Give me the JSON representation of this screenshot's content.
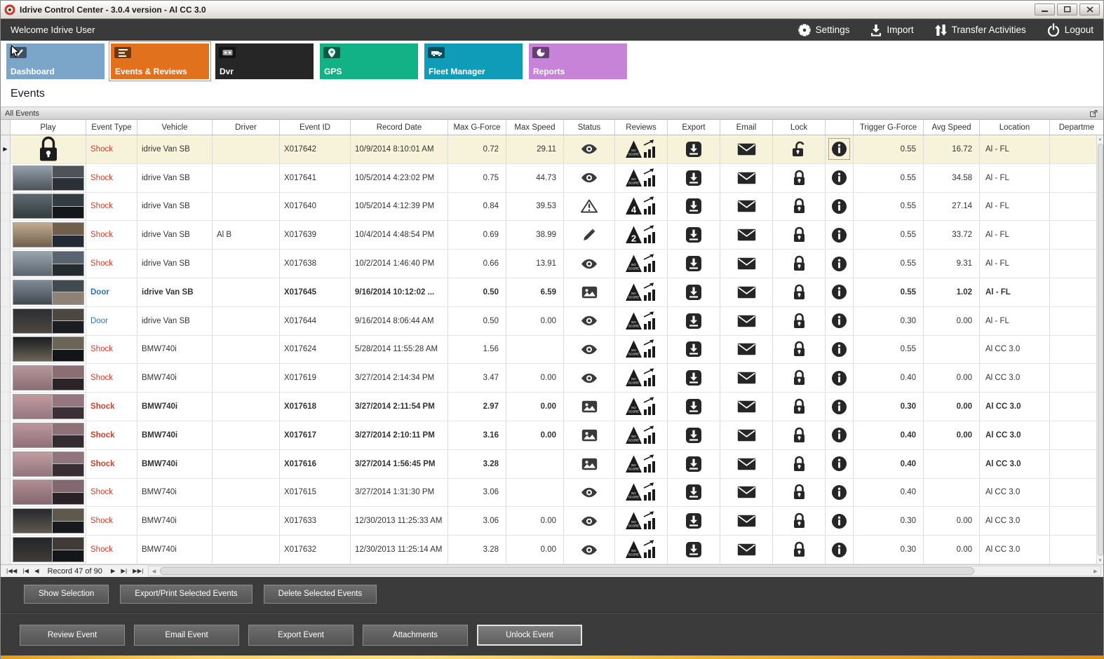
{
  "window": {
    "title": "Idrive Control Center - 3.0.4 version - Al CC 3.0",
    "controls": [
      "minimize",
      "maximize",
      "close"
    ]
  },
  "topbar": {
    "welcome": "Welcome Idrive User",
    "actions": [
      {
        "label": "Settings",
        "icon": "gear-icon"
      },
      {
        "label": "Import",
        "icon": "import-icon"
      },
      {
        "label": "Transfer Activities",
        "icon": "transfer-icon"
      },
      {
        "label": "Logout",
        "icon": "power-icon"
      }
    ]
  },
  "nav_tiles": [
    {
      "label": "Dashboard",
      "icon": "dashboard-check-icon",
      "color": "#7ba6c9",
      "selected": false
    },
    {
      "label": "Events & Reviews",
      "icon": "events-list-icon",
      "color": "#e2711e",
      "selected": true
    },
    {
      "label": "Dvr",
      "icon": "dvr-icon",
      "color": "#262626",
      "selected": false
    },
    {
      "label": "GPS",
      "icon": "gps-pin-icon",
      "color": "#12b286",
      "selected": false
    },
    {
      "label": "Fleet Manager",
      "icon": "fleet-vehicle-icon",
      "color": "#0f9cb9",
      "selected": false
    },
    {
      "label": "Reports",
      "icon": "reports-pie-icon",
      "color": "#c683d8",
      "selected": false
    }
  ],
  "page": {
    "title": "Events",
    "group_header": "All Events"
  },
  "table": {
    "columns": [
      "Play",
      "Event Type",
      "Vehicle",
      "Driver",
      "Event ID",
      "Record Date",
      "Max G-Force",
      "Max Speed",
      "Status",
      "Reviews",
      "Export",
      "Email",
      "Lock",
      "",
      "Trigger G-Force",
      "Avg Speed",
      "Location",
      "Departme"
    ],
    "rows": [
      {
        "event_type": "Shock",
        "vehicle": "idrive Van SB",
        "driver": "",
        "event_id": "X017642",
        "record_date": "10/9/2014 8:10:01 AM",
        "max_g": "0.72",
        "max_speed": "29.11",
        "status": "eye",
        "review": "NO SCORE",
        "lock": "open",
        "trigger_g": "0.55",
        "avg_speed": "16.72",
        "location": "Al - FL",
        "bold": false,
        "selected": true,
        "play": "lock",
        "thumb": null
      },
      {
        "event_type": "Shock",
        "vehicle": "idrive Van SB",
        "driver": "",
        "event_id": "X017641",
        "record_date": "10/5/2014 4:23:02 PM",
        "max_g": "0.75",
        "max_speed": "44.73",
        "status": "eye",
        "review": "NO SCORE",
        "lock": "closed",
        "trigger_g": "0.55",
        "avg_speed": "34.58",
        "location": "Al - FL",
        "bold": false,
        "selected": false,
        "play": "thumb",
        "thumb": [
          "#93a0ab",
          "#4d5359",
          "#2c3137"
        ]
      },
      {
        "event_type": "Shock",
        "vehicle": "idrive Van SB",
        "driver": "",
        "event_id": "X017640",
        "record_date": "10/5/2014 4:12:39 PM",
        "max_g": "0.84",
        "max_speed": "39.53",
        "status": "warning",
        "review": "4",
        "lock": "closed",
        "trigger_g": "0.55",
        "avg_speed": "27.14",
        "location": "Al - FL",
        "bold": false,
        "selected": false,
        "play": "thumb",
        "thumb": [
          "#5d6a70",
          "#333c3e",
          "#15181a"
        ]
      },
      {
        "event_type": "Shock",
        "vehicle": "idrive Van SB",
        "driver": "Al B",
        "event_id": "X017639",
        "record_date": "10/4/2014 4:48:54 PM",
        "max_g": "0.69",
        "max_speed": "38.99",
        "status": "pencil",
        "review": "2",
        "lock": "closed",
        "trigger_g": "0.55",
        "avg_speed": "33.72",
        "location": "Al - FL",
        "bold": false,
        "selected": false,
        "play": "thumb",
        "thumb": [
          "#c3ab8e",
          "#705f4d",
          "#232a36"
        ]
      },
      {
        "event_type": "Shock",
        "vehicle": "idrive Van SB",
        "driver": "",
        "event_id": "X017638",
        "record_date": "10/2/2014 1:46:40 PM",
        "max_g": "0.66",
        "max_speed": "13.91",
        "status": "eye",
        "review": "NO SCORE",
        "lock": "closed",
        "trigger_g": "0.55",
        "avg_speed": "9.31",
        "location": "Al - FL",
        "bold": false,
        "selected": false,
        "play": "thumb",
        "thumb": [
          "#9aa6ae",
          "#596470",
          "#262b31"
        ]
      },
      {
        "event_type": "Door",
        "vehicle": "idrive Van SB",
        "driver": "",
        "event_id": "X017645",
        "record_date": "9/16/2014 10:12:02 ...",
        "max_g": "0.50",
        "max_speed": "6.59",
        "status": "image",
        "review": "NO SCORE",
        "lock": "closed",
        "trigger_g": "0.55",
        "avg_speed": "1.02",
        "location": "Al - FL",
        "bold": true,
        "selected": false,
        "play": "thumb",
        "thumb": [
          "#7e8b96",
          "#424a51",
          "#8d8275"
        ]
      },
      {
        "event_type": "Door",
        "vehicle": "idrive Van SB",
        "driver": "",
        "event_id": "X017644",
        "record_date": "9/16/2014 8:06:44 AM",
        "max_g": "0.50",
        "max_speed": "0.00",
        "status": "eye",
        "review": "NO SCORE",
        "lock": "closed",
        "trigger_g": "0.30",
        "avg_speed": "0.00",
        "location": "Al - FL",
        "bold": false,
        "selected": false,
        "play": "thumb",
        "thumb": [
          "#2b2e33",
          "#4d4741",
          "#1b1d21"
        ]
      },
      {
        "event_type": "Shock",
        "vehicle": "BMW740i",
        "driver": "",
        "event_id": "X017624",
        "record_date": "5/28/2014 11:55:28 AM",
        "max_g": "1.56",
        "max_speed": "",
        "status": "eye",
        "review": "NO SCORE",
        "lock": "closed",
        "trigger_g": "0.55",
        "avg_speed": "",
        "location": "Al CC 3.0",
        "bold": false,
        "selected": false,
        "play": "thumb",
        "thumb": [
          "#1a1c20",
          "#6b6557",
          "#121417"
        ]
      },
      {
        "event_type": "Shock",
        "vehicle": "BMW740i",
        "driver": "",
        "event_id": "X017619",
        "record_date": "3/27/2014 2:14:34 PM",
        "max_g": "3.47",
        "max_speed": "0.00",
        "status": "eye",
        "review": "NO SCORE",
        "lock": "closed",
        "trigger_g": "0.40",
        "avg_speed": "0.00",
        "location": "Al CC 3.0",
        "bold": false,
        "selected": false,
        "play": "thumb",
        "thumb": [
          "#b6969a",
          "#8a6e74",
          "#2b2327"
        ]
      },
      {
        "event_type": "Shock",
        "vehicle": "BMW740i",
        "driver": "",
        "event_id": "X017618",
        "record_date": "3/27/2014 2:11:54 PM",
        "max_g": "2.97",
        "max_speed": "0.00",
        "status": "image",
        "review": "NO SCORE",
        "lock": "closed",
        "trigger_g": "0.30",
        "avg_speed": "0.00",
        "location": "Al CC 3.0",
        "bold": true,
        "selected": false,
        "play": "thumb",
        "thumb": [
          "#c29ba0",
          "#957680",
          "#3b3035"
        ]
      },
      {
        "event_type": "Shock",
        "vehicle": "BMW740i",
        "driver": "",
        "event_id": "X017617",
        "record_date": "3/27/2014 2:10:11 PM",
        "max_g": "3.16",
        "max_speed": "0.00",
        "status": "image",
        "review": "NO SCORE",
        "lock": "closed",
        "trigger_g": "0.40",
        "avg_speed": "0.00",
        "location": "Al CC 3.0",
        "bold": true,
        "selected": false,
        "play": "thumb",
        "thumb": [
          "#bd979c",
          "#8f7078",
          "#352c31"
        ]
      },
      {
        "event_type": "Shock",
        "vehicle": "BMW740i",
        "driver": "",
        "event_id": "X017616",
        "record_date": "3/27/2014 1:56:45 PM",
        "max_g": "3.28",
        "max_speed": "",
        "status": "image",
        "review": "NO SCORE",
        "lock": "closed",
        "trigger_g": "0.40",
        "avg_speed": "",
        "location": "Al CC 3.0",
        "bold": true,
        "selected": false,
        "play": "thumb",
        "thumb": [
          "#c09da1",
          "#92747c",
          "#382e33"
        ]
      },
      {
        "event_type": "Shock",
        "vehicle": "BMW740i",
        "driver": "",
        "event_id": "X017615",
        "record_date": "3/27/2014 1:31:30 PM",
        "max_g": "3.06",
        "max_speed": "",
        "status": "eye",
        "review": "NO SCORE",
        "lock": "closed",
        "trigger_g": "0.40",
        "avg_speed": "",
        "location": "Al CC 3.0",
        "bold": false,
        "selected": false,
        "play": "thumb",
        "thumb": [
          "#b28e92",
          "#846870",
          "#2a2226"
        ]
      },
      {
        "event_type": "Shock",
        "vehicle": "BMW740i",
        "driver": "",
        "event_id": "X017633",
        "record_date": "12/30/2013 11:25:33 AM",
        "max_g": "3.06",
        "max_speed": "0.00",
        "status": "eye",
        "review": "NO SCORE",
        "lock": "closed",
        "trigger_g": "0.30",
        "avg_speed": "0.00",
        "location": "Al CC 3.0",
        "bold": false,
        "selected": false,
        "play": "thumb",
        "thumb": [
          "#26292d",
          "#5f584f",
          "#17191c"
        ]
      },
      {
        "event_type": "Shock",
        "vehicle": "BMW740i",
        "driver": "",
        "event_id": "X017632",
        "record_date": "12/30/2013 11:25:14 AM",
        "max_g": "3.28",
        "max_speed": "0.00",
        "status": "eye",
        "review": "NO SCORE",
        "lock": "closed",
        "trigger_g": "0.30",
        "avg_speed": "0.00",
        "location": "Al CC 3.0",
        "bold": false,
        "selected": false,
        "play": "thumb",
        "thumb": [
          "#222528",
          "#403b36",
          "#141619"
        ]
      }
    ]
  },
  "record_nav": {
    "label": "Record 47 of 90",
    "vcr_left": [
      "|◀◀",
      "|◀",
      "◀"
    ],
    "vcr_right": [
      "▶",
      "▶|",
      "▶▶|"
    ]
  },
  "selection_buttons": [
    "Show Selection",
    "Export/Print Selected Events",
    "Delete Selected  Events"
  ],
  "event_buttons": [
    {
      "label": "Review Event",
      "focused": false
    },
    {
      "label": "Email Event",
      "focused": false
    },
    {
      "label": "Export Event",
      "focused": false
    },
    {
      "label": "Attachments",
      "focused": false
    },
    {
      "label": "Unlock Event",
      "focused": true
    }
  ],
  "colors": {
    "shock_text": "#c7422f",
    "door_text": "#2e74b5",
    "selected_row_bg": "#f6f3da",
    "topbar_bg": "#3a3a3a",
    "panel_bg": "#3b3b3b",
    "selected_tile": "#e2711e"
  }
}
